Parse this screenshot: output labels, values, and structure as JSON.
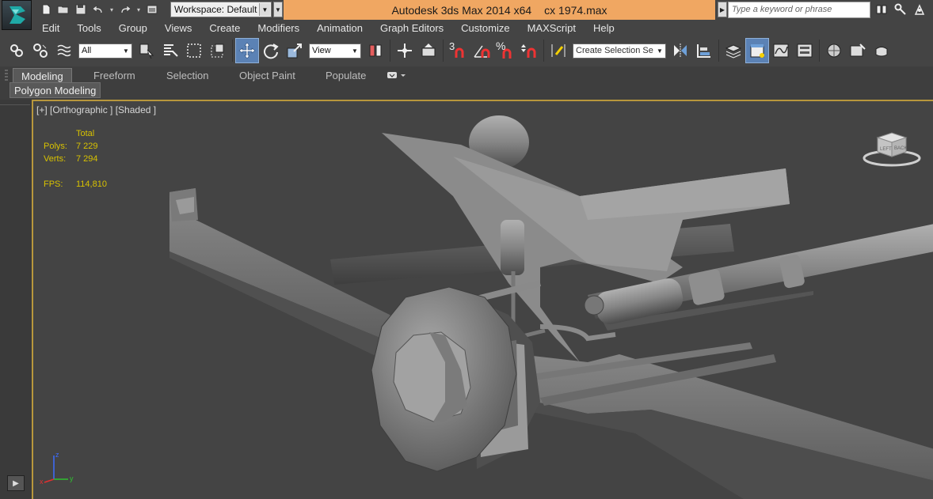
{
  "titlebar": {
    "workspace_label": "Workspace: Default",
    "app_title": "Autodesk 3ds Max  2014 x64",
    "file_name": "cx 1974.max",
    "search_placeholder": "Type a keyword or phrase"
  },
  "menu": [
    "Edit",
    "Tools",
    "Group",
    "Views",
    "Create",
    "Modifiers",
    "Animation",
    "Graph Editors",
    "Customize",
    "MAXScript",
    "Help"
  ],
  "toolbar": {
    "selection_filter": "All",
    "reference_coord": "View",
    "named_selection_placeholder": "Create Selection Se",
    "snap_label": "3"
  },
  "ribbon": {
    "tabs": [
      "Modeling",
      "Freeform",
      "Selection",
      "Object Paint",
      "Populate"
    ],
    "active_tab": "Modeling",
    "panel_label": "Polygon Modeling"
  },
  "viewport": {
    "label": "[+] [Orthographic ] [Shaded ]",
    "stats": {
      "header": "Total",
      "polys_label": "Polys:",
      "polys_value": "7 229",
      "verts_label": "Verts:",
      "verts_value": "7 294",
      "fps_label": "FPS:",
      "fps_value": "114,810"
    },
    "viewcube_labels": {
      "left": "LEFT",
      "back": "BACK"
    }
  },
  "colors": {
    "title_bar": "#f0a762",
    "active_viewport_border": "#b8973c",
    "stats_text": "#d8c200",
    "active_tool": "#5b82b5"
  },
  "icons": [
    "app-logo-icon",
    "new-file-icon",
    "open-file-icon",
    "save-icon",
    "undo-icon",
    "redo-icon",
    "project-folder-icon",
    "binoculars-icon",
    "key-icon",
    "star-icon",
    "link-icon",
    "unlink-icon",
    "bind-space-warp-icon",
    "select-object-icon",
    "select-by-name-icon",
    "rect-region-icon",
    "window-crossing-icon",
    "move-icon",
    "rotate-icon",
    "scale-icon",
    "pivot-icon",
    "manipulate-icon",
    "keyboard-shortcut-icon",
    "snap-icon",
    "angle-snap-icon",
    "percent-snap-icon",
    "spinner-snap-icon",
    "edit-named-selection-icon",
    "mirror-icon",
    "align-icon",
    "layers-icon",
    "graphite-tools-icon",
    "curve-editor-icon",
    "schematic-view-icon",
    "material-editor-icon",
    "render-setup-icon",
    "teapot-icon"
  ]
}
